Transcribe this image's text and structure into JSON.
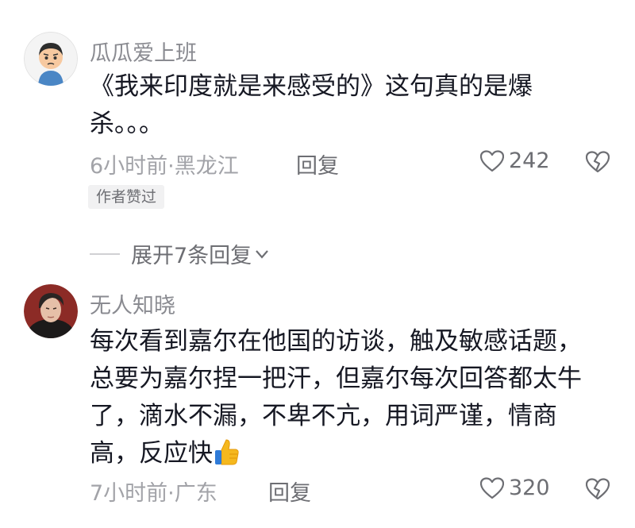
{
  "comments": [
    {
      "username": "瓜瓜爱上班",
      "text": "《我来印度就是来感受的》这句真的是爆杀。。。",
      "meta": "6小时前·黑龙江",
      "reply_label": "回复",
      "likes": "242",
      "author_badge": "作者赞过",
      "expand_label": "展开7条回复"
    },
    {
      "username": "无人知晓",
      "text": "每次看到嘉尔在他国的访谈，触及敏感话题，总要为嘉尔捏一把汗，但嘉尔每次回答都太牛了，滴水不漏，不卑不亢，用词严谨，情商高，反应快",
      "meta": "7小时前·广东",
      "reply_label": "回复",
      "likes": "320"
    }
  ],
  "icons": {
    "like": "heart-outline-icon",
    "dislike": "broken-heart-icon",
    "expand": "chevron-down-icon",
    "emoji": "thumbs-up-emoji"
  },
  "colors": {
    "text_primary": "#161823",
    "text_secondary": "#8a8b91",
    "badge_bg": "#f1f1f2"
  }
}
